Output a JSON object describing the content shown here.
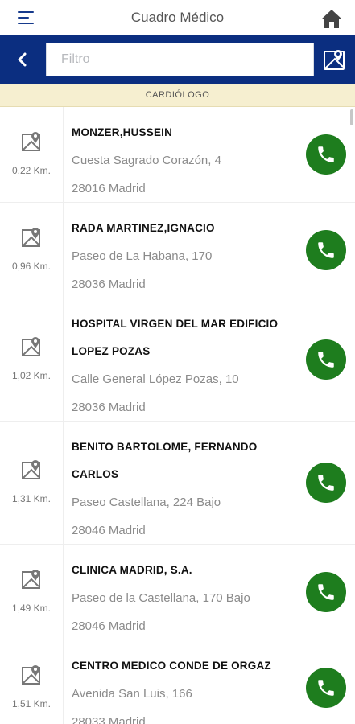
{
  "header": {
    "title": "Cuadro Médico",
    "menu_icon": "hamburger-menu-icon",
    "home_icon": "home-icon"
  },
  "search": {
    "placeholder": "Filtro",
    "value": "",
    "back_icon": "chevron-left-icon",
    "map_icon": "map-icon"
  },
  "category": "CARDIÓLOGO",
  "colors": {
    "nav_bar": "#0b2e80",
    "category_bg": "#f6efd0",
    "call_button": "#1e7d1e"
  },
  "results": [
    {
      "distance": "0,22 Km.",
      "name": [
        "MONZER,HUSSEIN"
      ],
      "address": "Cuesta Sagrado Corazón, 4",
      "postal": "28016 Madrid"
    },
    {
      "distance": "0,96 Km.",
      "name": [
        "RADA MARTINEZ,IGNACIO"
      ],
      "address": "Paseo de La Habana, 170",
      "postal": "28036 Madrid"
    },
    {
      "distance": "1,02 Km.",
      "name": [
        "HOSPITAL VIRGEN DEL MAR EDIFICIO",
        "LOPEZ POZAS"
      ],
      "address": "Calle General López Pozas, 10",
      "postal": "28036 Madrid"
    },
    {
      "distance": "1,31 Km.",
      "name": [
        "BENITO BARTOLOME, FERNANDO",
        "CARLOS"
      ],
      "address": "Paseo Castellana, 224 Bajo",
      "postal": "28046 Madrid"
    },
    {
      "distance": "1,49 Km.",
      "name": [
        "CLINICA MADRID, S.A."
      ],
      "address": "Paseo de la Castellana, 170 Bajo",
      "postal": "28046 Madrid"
    },
    {
      "distance": "1,51 Km.",
      "name": [
        "CENTRO MEDICO CONDE DE ORGAZ"
      ],
      "address": "Avenida San Luis, 166",
      "postal": "28033 Madrid"
    }
  ]
}
